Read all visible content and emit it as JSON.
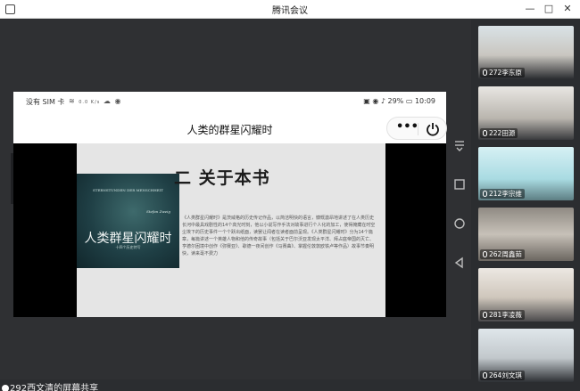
{
  "window": {
    "title": "腾讯会议",
    "minimize_glyph": "—",
    "maximize_glyph": "□",
    "close_glyph": "✕"
  },
  "phone": {
    "status": {
      "carrier": "没有 SIM 卡",
      "speed": "0.0 K/s",
      "battery": "29%",
      "time": "10:09"
    },
    "header": {
      "title": "人类的群星闪耀时",
      "more_glyph": "•••"
    }
  },
  "slide": {
    "heading": "二  关于本书",
    "body": "《人类群星闪耀时》是茨威格的历史传记作品，以简洁明快的语言，慷慨激昂地讲述了在人类历史长河中最具戏剧性的14个高光时刻，他以小说写作手法对故事进行个人化的加工，使得掩藏在时空尘埃下的历史事件一个个跃出纸面，读罢让闻者在读者面前呈现。《人类群星闪耀时》分为14个篇章，每篇讲述一个英雄人物和他的传奇故事（包括关于巴尔沃亚发现太平洋、拜占庭帝国的灭亡、亨德尔困境中创作《弥赛亚》、歌德一夜间创作《马赛曲》、掌握伦敦敦欧铁卢等作品）故事节奏明快，读来毫不费力",
    "book": {
      "publisher": "STERNSTUNDEN DER MENSCHHEIT",
      "author": "Stefan Zweig",
      "title": "人类群星闪耀时",
      "subtitle": "十四个历史特写"
    }
  },
  "screen_share": {
    "label": "292西文清的屏幕共享"
  },
  "participants": [
    {
      "name": "272李东原"
    },
    {
      "name": "222田源"
    },
    {
      "name": "212李宗维"
    },
    {
      "name": "262周鑫茹"
    },
    {
      "name": "281李凌薇"
    },
    {
      "name": "264刘文琪"
    }
  ],
  "colors": {
    "titlebar": "#ffffff",
    "stage": "#2f3033",
    "slide_bg": "#e5e5e5",
    "book_cover": "#1f3f45"
  },
  "icons": [
    "app-icon",
    "chevron-right-icon",
    "power-icon",
    "more-icon",
    "nav-menu-icon",
    "nav-square-icon",
    "nav-circle-icon",
    "nav-back-icon",
    "mic-icon"
  ]
}
